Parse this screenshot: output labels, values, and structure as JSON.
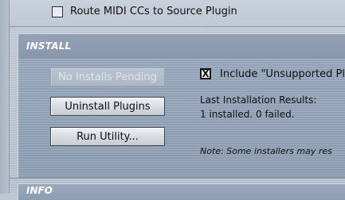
{
  "top_option": {
    "label": "Route MIDI CCs to Source Plugin",
    "checked": false
  },
  "install_section": {
    "title": "INSTALL",
    "buttons": {
      "no_installs_pending": "No Installs Pending",
      "uninstall_plugins": "Uninstall Plugins",
      "run_utility": "Run Utility..."
    },
    "include_unsupported": {
      "label": "Include \"Unsupported Pl",
      "checked": true,
      "mark": "X"
    },
    "results_title": "Last Installation Results:",
    "results_text": "1 installed. 0 failed.",
    "note": "Note: Some installers may res"
  },
  "info_section": {
    "title": "INFO"
  },
  "colors": {
    "section_header": "#8f9db2",
    "panel_background": "#bcc7d3",
    "section_body": "#94a3b8",
    "header_text": "#ffffff"
  }
}
